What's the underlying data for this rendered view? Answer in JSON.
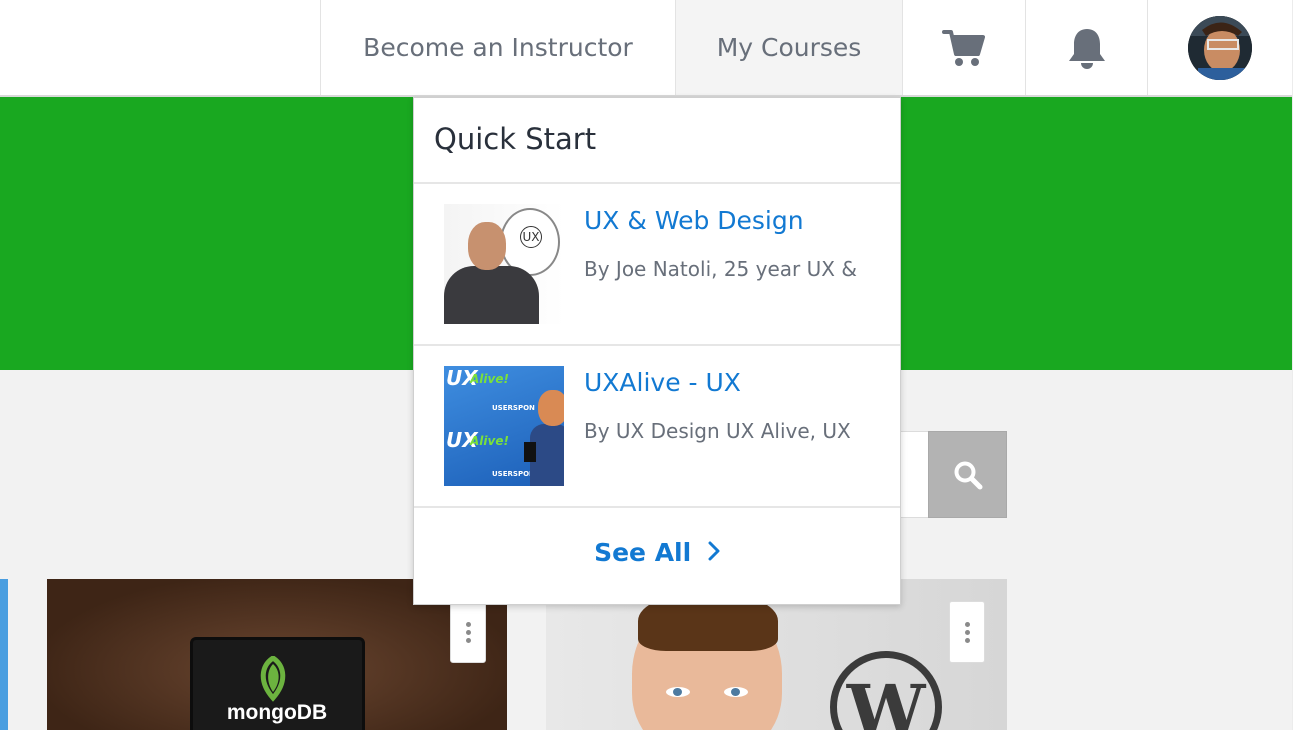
{
  "header": {
    "become_instructor": "Become an Instructor",
    "my_courses": "My Courses",
    "icons": {
      "cart": "cart-icon",
      "bell": "bell-icon",
      "avatar": "user-avatar"
    }
  },
  "colors": {
    "hero_green": "#19a820",
    "link_blue": "#1279d2",
    "nav_text": "#686f7a",
    "search_button": "#b3b3b3"
  },
  "dropdown": {
    "title": "Quick Start",
    "courses": [
      {
        "title": "UX & Web Design",
        "author": "By Joe Natoli, 25 year UX &"
      },
      {
        "title": "UXAlive - UX",
        "author": "By UX Design UX Alive, UX"
      }
    ],
    "see_all": "See All"
  },
  "thumb2": {
    "brand": "UX",
    "alive": "Alive!",
    "sponsor": "USERSPON"
  },
  "cards": {
    "mongo_text": "mongoDB",
    "wp_text": "W"
  }
}
